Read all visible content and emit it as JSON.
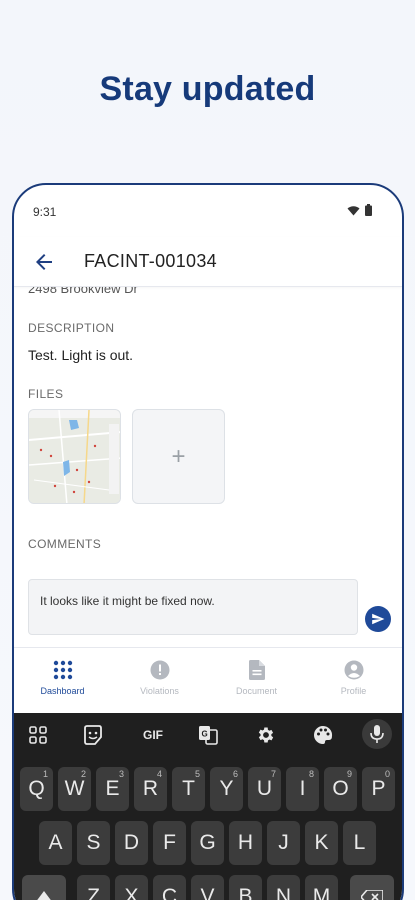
{
  "headline": "Stay updated",
  "status_bar": {
    "time": "9:31"
  },
  "app_bar": {
    "title": "FACINT-001034"
  },
  "detail": {
    "address": "2498 Brookview Dr",
    "description_label": "DESCRIPTION",
    "description_text": "Test.  Light is out.",
    "files_label": "FILES",
    "add_file_symbol": "+",
    "comments_label": "COMMENTS",
    "comment_input_value": "It looks like it might be fixed now."
  },
  "bottom_nav": {
    "items": [
      {
        "label": "Dashboard",
        "icon": "grid-icon",
        "active": true
      },
      {
        "label": "Violations",
        "icon": "alert-icon",
        "active": false
      },
      {
        "label": "Document",
        "icon": "document-icon",
        "active": false
      },
      {
        "label": "Profile",
        "icon": "profile-icon",
        "active": false
      }
    ]
  },
  "keyboard": {
    "toolbar": {
      "gif_label": "GIF"
    },
    "row1": [
      "Q",
      "W",
      "E",
      "R",
      "T",
      "Y",
      "U",
      "I",
      "O",
      "P"
    ],
    "row1_hints": [
      "1",
      "2",
      "3",
      "4",
      "5",
      "6",
      "7",
      "8",
      "9",
      "0"
    ],
    "row2": [
      "A",
      "S",
      "D",
      "F",
      "G",
      "H",
      "J",
      "K",
      "L"
    ],
    "row3": [
      "Z",
      "X",
      "C",
      "V",
      "B",
      "N",
      "M"
    ]
  },
  "colors": {
    "brand": "#163a7a",
    "accent": "#1f4a99"
  }
}
